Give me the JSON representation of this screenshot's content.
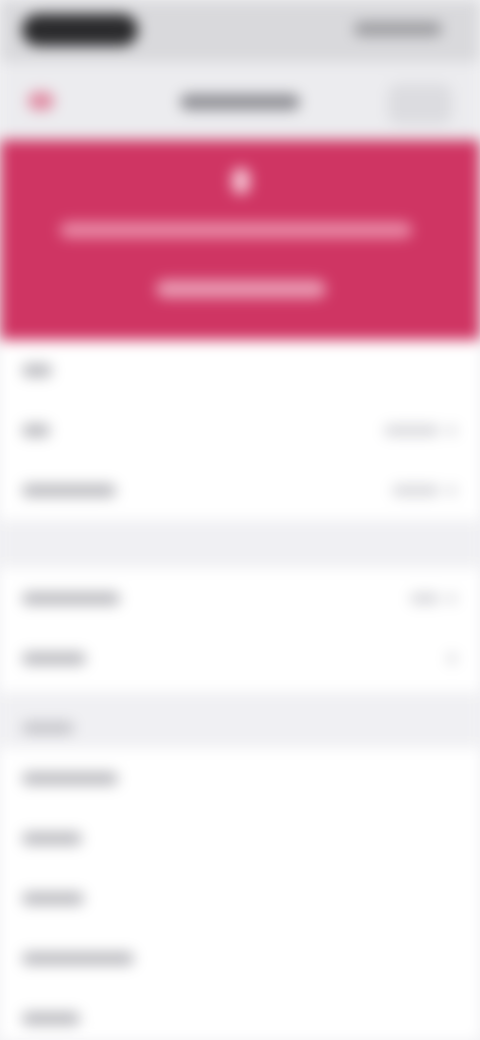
{
  "colors": {
    "banner": "#cf3563",
    "accent": "#e08aa2",
    "background": "#f2f2f4",
    "cell": "#ffffff"
  },
  "status_bar": {
    "time": "",
    "indicators": ""
  },
  "nav": {
    "back_icon": "chevron-left-icon",
    "title": "",
    "action": ""
  },
  "banner": {
    "icon": "info-icon",
    "message": "",
    "link": ""
  },
  "section_1": {
    "rows": [
      {
        "label": "",
        "value": ""
      },
      {
        "label": "",
        "value": ""
      },
      {
        "label": "",
        "value": ""
      }
    ]
  },
  "section_2": {
    "rows": [
      {
        "label": "",
        "value": ""
      },
      {
        "label": "",
        "value": ""
      }
    ]
  },
  "section_3": {
    "header": "",
    "rows": [
      {
        "label": ""
      },
      {
        "label": ""
      },
      {
        "label": ""
      },
      {
        "label": ""
      },
      {
        "label": ""
      }
    ]
  }
}
